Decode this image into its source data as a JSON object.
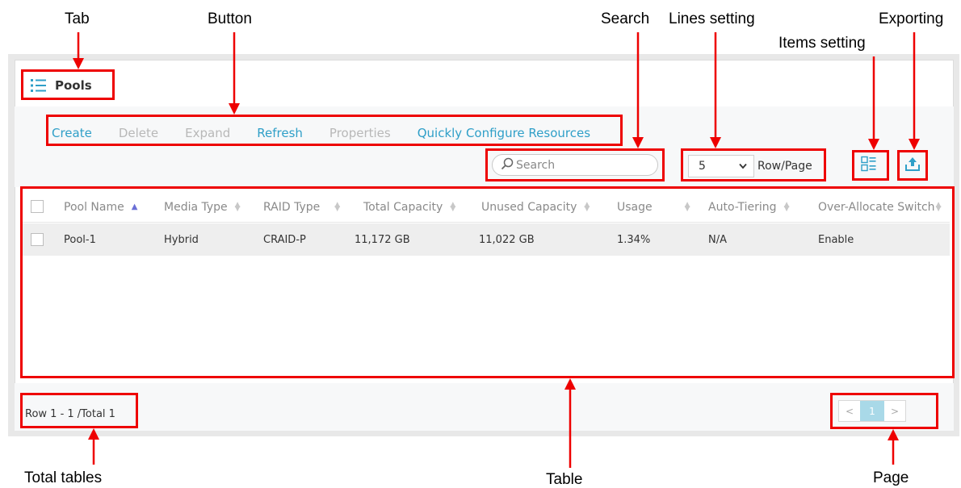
{
  "callouts": {
    "tab": "Tab",
    "button": "Button",
    "search": "Search",
    "lines_setting": "Lines setting",
    "items_setting": "Items setting",
    "exporting": "Exporting",
    "total_tables": "Total tables",
    "table": "Table",
    "page": "Page"
  },
  "tab": {
    "label": "Pools",
    "icon": "list-icon"
  },
  "actions": {
    "create": "Create",
    "delete": "Delete",
    "expand": "Expand",
    "refresh": "Refresh",
    "properties": "Properties",
    "quick_config": "Quickly Configure Resources"
  },
  "search": {
    "placeholder": "Search"
  },
  "rows_per_page": {
    "value": "5",
    "label": "Row/Page"
  },
  "table": {
    "columns": [
      "Pool Name",
      "Media Type",
      "RAID Type",
      "Total Capacity",
      "Unused Capacity",
      "Usage",
      "Auto-Tiering",
      "Over-Allocate Switch"
    ],
    "rows": [
      {
        "pool_name": "Pool-1",
        "media_type": "Hybrid",
        "raid_type": "CRAID-P",
        "total_capacity": "11,172 GB",
        "unused_capacity": "11,022 GB",
        "usage": "1.34%",
        "auto_tiering": "N/A",
        "over_allocate": "Enable"
      }
    ]
  },
  "footer": {
    "total": "Row 1 - 1 /Total 1"
  },
  "pager": {
    "prev": "<",
    "current": "1",
    "next": ">"
  },
  "colors": {
    "accent": "#2f9fc8",
    "disabled": "#b8b8b8",
    "annotation": "#ee0000",
    "pager_current": "#a9d9e8"
  }
}
